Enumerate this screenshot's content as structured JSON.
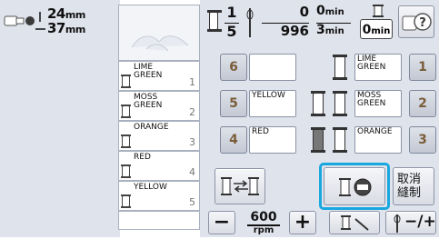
{
  "size": {
    "width": "24",
    "height": "37",
    "unit": "mm"
  },
  "status": {
    "color_index": "1",
    "color_total": "5",
    "stitch_count": "0",
    "stitch_total": "996",
    "time_elapsed": "0",
    "time_total": "3",
    "time_unit": "min",
    "change_time": "0",
    "change_unit": "min"
  },
  "list_rows": [
    {
      "color": "LIME\nGREEN",
      "num": "1"
    },
    {
      "color": "MOSS\nGREEN",
      "num": "2"
    },
    {
      "color": "ORANGE",
      "num": "3"
    },
    {
      "color": "RED",
      "num": "4"
    },
    {
      "color": "YELLOW",
      "num": "5"
    },
    {
      "color": "",
      "num": ""
    }
  ],
  "spool_grid": [
    {
      "left_num": "6",
      "left_color": "",
      "right_color": "LIME\nGREEN",
      "right_num": "1"
    },
    {
      "left_num": "5",
      "left_color": "YELLOW",
      "right_color": "MOSS\nGREEN",
      "right_num": "2"
    },
    {
      "left_num": "4",
      "left_color": "RED",
      "right_color": "ORANGE",
      "right_num": "3"
    }
  ],
  "speed": {
    "value": "600",
    "unit": "rpm"
  },
  "buttons": {
    "cancel_label": "取消\n縫制",
    "minus": "−",
    "plus": "+",
    "needle_pm": "−/+"
  }
}
